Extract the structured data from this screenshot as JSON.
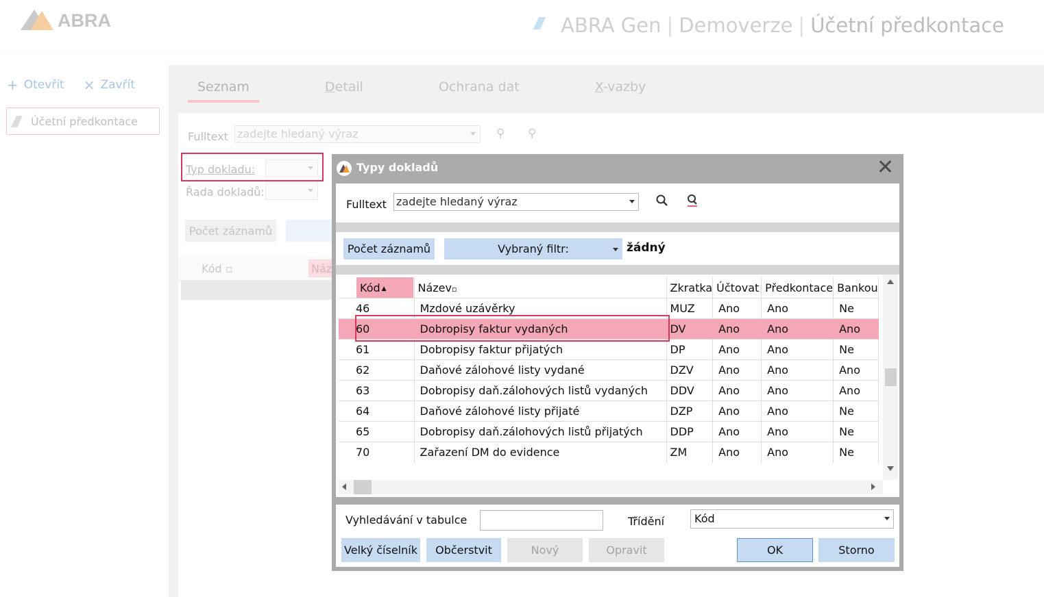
{
  "app": {
    "logo_text": "ABRA",
    "title_parts": [
      "ABRA Gen",
      "Demoverze",
      "Účetní předkontace"
    ],
    "title_sep": "|"
  },
  "sidebar": {
    "open_label": "Otevřít",
    "close_label": "Zavřít",
    "item_label": "Účetní předkontace"
  },
  "tabs": [
    {
      "pre": "",
      "ul": "",
      "label": "Seznam"
    },
    {
      "pre": "",
      "ul": "D",
      "label": "etail"
    },
    {
      "pre": "",
      "ul": "",
      "label": "Ochrana dat"
    },
    {
      "pre": "",
      "ul": "X",
      "label": "-vazby"
    }
  ],
  "background_form": {
    "fulltext_label": "Fulltext",
    "fulltext_placeholder": "zadejte hledaný výraz",
    "typ_label": "Typ dokladu:",
    "rada_label": "Řada dokladů:",
    "count_button": "Počet záznamů",
    "grid_kod": "Kód",
    "grid_naz": "Náz"
  },
  "dialog": {
    "title": "Typy dokladů",
    "fulltext_label": "Fulltext",
    "fulltext_value": "zadejte hledaný výraz",
    "count_button": "Počet záznamů",
    "filter_label": "Vybraný filtr:",
    "filter_value": "žádný",
    "columns": [
      "Kód",
      "Název",
      "Zkratka",
      "Účtovat",
      "Předkontace",
      "Bankou"
    ],
    "sort_marks": {
      "kod": "▲",
      "nazev": "▫"
    },
    "rows": [
      {
        "kod": "46",
        "nazev": "Mzdové uzávěrky",
        "zkratka": "MUZ",
        "uctovat": "Ano",
        "predkontace": "Ano",
        "bankou": "Ne"
      },
      {
        "kod": "60",
        "nazev": "Dobropisy faktur vydaných",
        "zkratka": "DV",
        "uctovat": "Ano",
        "predkontace": "Ano",
        "bankou": "Ano"
      },
      {
        "kod": "61",
        "nazev": "Dobropisy faktur přijatých",
        "zkratka": "DP",
        "uctovat": "Ano",
        "predkontace": "Ano",
        "bankou": "Ne"
      },
      {
        "kod": "62",
        "nazev": "Daňové zálohové listy vydané",
        "zkratka": "DZV",
        "uctovat": "Ano",
        "predkontace": "Ano",
        "bankou": "Ano"
      },
      {
        "kod": "63",
        "nazev": "Dobropisy daň.zálohových listů vydaných",
        "zkratka": "DDV",
        "uctovat": "Ano",
        "predkontace": "Ano",
        "bankou": "Ano"
      },
      {
        "kod": "64",
        "nazev": "Daňové zálohové listy přijaté",
        "zkratka": "DZP",
        "uctovat": "Ano",
        "predkontace": "Ano",
        "bankou": "Ne"
      },
      {
        "kod": "65",
        "nazev": "Dobropisy daň.zálohových listů přijatých",
        "zkratka": "DDP",
        "uctovat": "Ano",
        "predkontace": "Ano",
        "bankou": "Ne"
      },
      {
        "kod": "70",
        "nazev": "Zařazení DM do evidence",
        "zkratka": "ZM",
        "uctovat": "Ano",
        "predkontace": "Ano",
        "bankou": "Ne"
      }
    ],
    "selected_row_index": 1,
    "table_search_label": "Vyhledávání v tabulce",
    "table_search_value": "",
    "sort_label": "Třídění",
    "sort_value": "Kód",
    "buttons": {
      "big_list": "Velký číselník",
      "refresh": "Občerstvit",
      "new": "Nový",
      "edit": "Opravit",
      "ok": "OK",
      "cancel": "Storno"
    }
  },
  "colors": {
    "selection": "#f4a7b6",
    "highlight_frame": "#d4395a",
    "button_blue": "#c6dbf2"
  }
}
